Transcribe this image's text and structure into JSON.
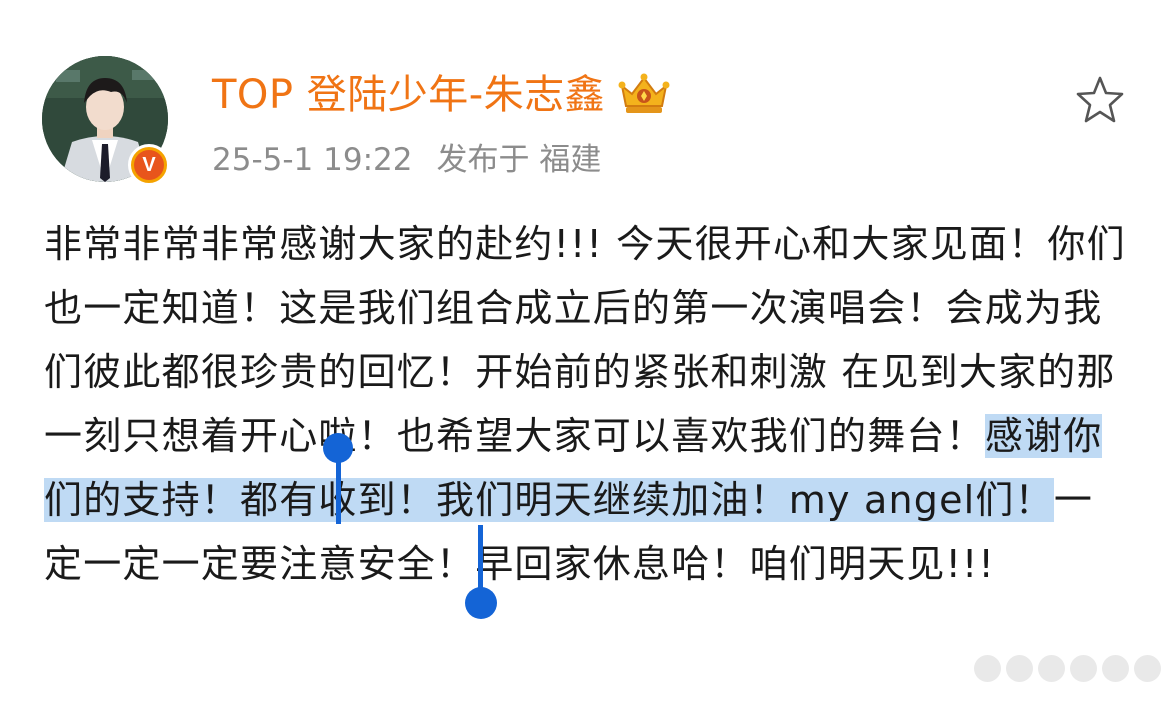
{
  "post": {
    "author": {
      "name": "TOP 登陆少年-朱志鑫",
      "verified_badge": "V",
      "avatar_icon": "user-avatar-icon",
      "member_icon": "crown-icon"
    },
    "meta": {
      "date": "25-5-1 19:22",
      "location": "发布于 福建"
    },
    "favorite_icon": "star-icon",
    "body": {
      "before": "非常非常非常感谢大家的赴约!!! 今天很开心和大家见面！你们也一定知道！这是我们组合成立后的第一次演唱会！会成为我们彼此都很珍贵的回忆！开始前的紧张和刺激 在见到大家的那一刻只想着开心啦！也希望大家可以喜欢我们的舞台！",
      "selected": "感谢你们的支持！都有收到！我们明天继续加油！my angel们！",
      "after": "一定一定一定要注意安全！早回家休息哈！咱们明天见!!!"
    },
    "colors": {
      "accent": "#f07414",
      "selection": "#bfdaf4",
      "handle": "#1464d6",
      "meta": "#8c8c8c"
    }
  }
}
